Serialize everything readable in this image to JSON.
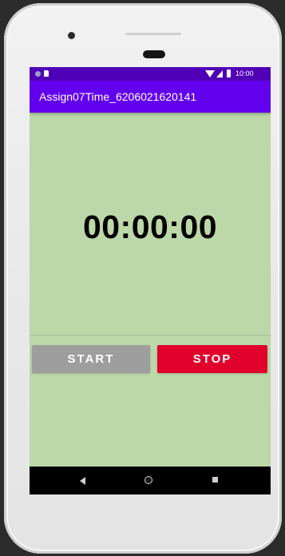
{
  "status_bar": {
    "time": "10:00",
    "icons": [
      "notification-dot-icon",
      "sd-card-icon",
      "wifi-icon",
      "cell-signal-icon",
      "battery-icon"
    ]
  },
  "app_bar": {
    "title": "Assign07Time_6206021620141",
    "color": "#6200ee"
  },
  "timer": {
    "display": "00:00:00"
  },
  "buttons": {
    "start_label": "START",
    "stop_label": "STOP",
    "start_color": "#9e9e9e",
    "stop_color": "#e0002b"
  },
  "nav_bar": {
    "icons": [
      "back-icon",
      "home-icon",
      "recents-icon"
    ]
  },
  "colors": {
    "status_bar": "#4f00b7",
    "content_background": "#bcd7a8"
  }
}
